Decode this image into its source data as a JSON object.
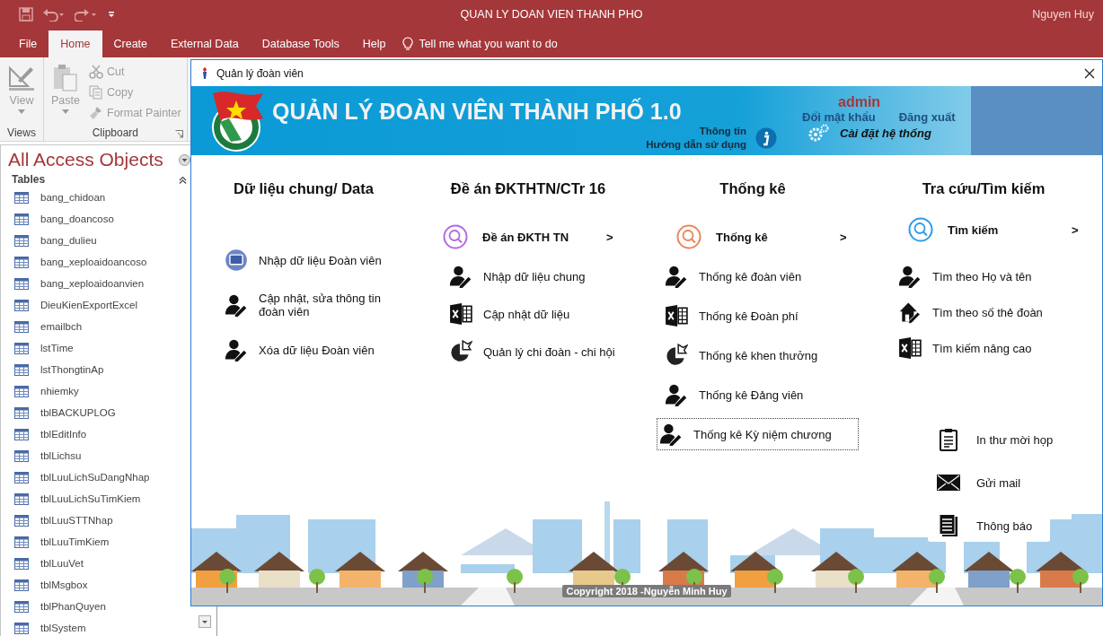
{
  "app": {
    "title": "QUAN LY DOAN VIEN THANH PHO",
    "user": "Nguyen Huy"
  },
  "ribbon_tabs": [
    {
      "label": "File",
      "selected": false
    },
    {
      "label": "Home",
      "selected": true
    },
    {
      "label": "Create",
      "selected": false
    },
    {
      "label": "External Data",
      "selected": false
    },
    {
      "label": "Database Tools",
      "selected": false
    },
    {
      "label": "Help",
      "selected": false
    }
  ],
  "tell_me": {
    "placeholder": "Tell me what you want to do"
  },
  "ribbon_groups": [
    {
      "label": "Views",
      "commands": [
        {
          "label": "View",
          "kind": "large",
          "disabled": true
        }
      ]
    },
    {
      "label": "Clipboard",
      "commands": [
        {
          "label": "Paste",
          "kind": "large",
          "disabled": true
        },
        {
          "label": "Cut",
          "kind": "small",
          "disabled": true
        },
        {
          "label": "Copy",
          "kind": "small",
          "disabled": true
        },
        {
          "label": "Format Painter",
          "kind": "small",
          "disabled": true
        }
      ]
    }
  ],
  "nav_pane": {
    "title": "All Access Objects",
    "section": {
      "label": "Tables",
      "expanded": true,
      "items": [
        "bang_chidoan",
        "bang_doancoso",
        "bang_dulieu",
        "bang_xeploaidoancoso",
        "bang_xeploaidoanvien",
        "DieuKienExportExcel",
        "emailbch",
        "lstTime",
        "lstThongtinAp",
        "nhiemky",
        "tblBACKUPLOG",
        "tblEditInfo",
        "tblLichsu",
        "tblLuuLichSuDangNhap",
        "tblLuuLichSuTimKiem",
        "tblLuuSTTNhap",
        "tblLuuTimKiem",
        "tblLuuVet",
        "tblMsgbox",
        "tblPhanQuyen",
        "tblSystem"
      ]
    }
  },
  "form": {
    "title": "Quản lý đoàn viên",
    "banner": {
      "title": "QUẢN LÝ ĐOÀN VIÊN THÀNH PHỐ 1.0",
      "links": [
        "Thông tin",
        "Hướng dẫn sử dụng"
      ],
      "user": "admin",
      "change_password": "Đổi mật khẩu",
      "logout": "Đăng xuất",
      "settings": "Cài đặt hệ thống"
    },
    "columns": [
      {
        "heading": "Dữ liệu chung/ Data",
        "items": [
          {
            "kind": "monitor",
            "label": "Nhập dữ liệu Đoàn viên",
            "focused": false
          },
          {
            "kind": "person",
            "label": "Cập nhật, sửa thông tin đoàn viên",
            "focused": false
          },
          {
            "kind": "person",
            "label": "Xóa dữ liệu Đoàn viên",
            "focused": false
          }
        ]
      },
      {
        "heading": "Đề án ĐKTHTN/CTr 16",
        "items": [
          {
            "kind": "main",
            "label": "Đề án ĐKTH TN",
            "arrow": ">",
            "color": "#b36ae2"
          },
          {
            "kind": "person",
            "label": "Nhập dữ liệu chung",
            "focused": false
          },
          {
            "kind": "spreadsheet",
            "label": "Cập nhật dữ liệu",
            "focused": false
          },
          {
            "kind": "pie",
            "label": "Quản lý chi đoàn - chi hội",
            "focused": false
          }
        ]
      },
      {
        "heading": "Thống kê",
        "items": [
          {
            "kind": "main",
            "label": "Thống kê",
            "arrow": ">",
            "color": "#e8875a"
          },
          {
            "kind": "person",
            "label": "Thống kê đoàn viên",
            "focused": false
          },
          {
            "kind": "spreadsheet",
            "label": "Thống kê Đoàn phí",
            "focused": false
          },
          {
            "kind": "pie",
            "label": "Thống kê khen thưởng",
            "focused": false
          },
          {
            "kind": "person",
            "label": "Thống kê Đảng viên",
            "focused": false
          },
          {
            "kind": "person",
            "label": "Thống kê Kỳ niệm chương",
            "focused": true
          }
        ]
      },
      {
        "heading": "Tra cứu/Tìm kiếm",
        "items": [
          {
            "kind": "main",
            "label": "Tìm kiếm",
            "arrow": ">",
            "color": "#2d9be8"
          },
          {
            "kind": "person",
            "label": "Tìm theo Họ và tên",
            "focused": false
          },
          {
            "kind": "house",
            "label": "Tìm theo số thẻ đoàn",
            "focused": false
          },
          {
            "kind": "spreadsheet",
            "label": "Tìm kiếm nâng cao",
            "focused": false
          }
        ]
      }
    ],
    "extras": [
      {
        "kind": "clipboard",
        "label": "In thư mời họp"
      },
      {
        "kind": "envelope",
        "label": "Gửi mail"
      },
      {
        "kind": "document",
        "label": "Thông báo"
      }
    ],
    "copyright": "Copyright 2018 -Nguyễn Minh Huy"
  }
}
